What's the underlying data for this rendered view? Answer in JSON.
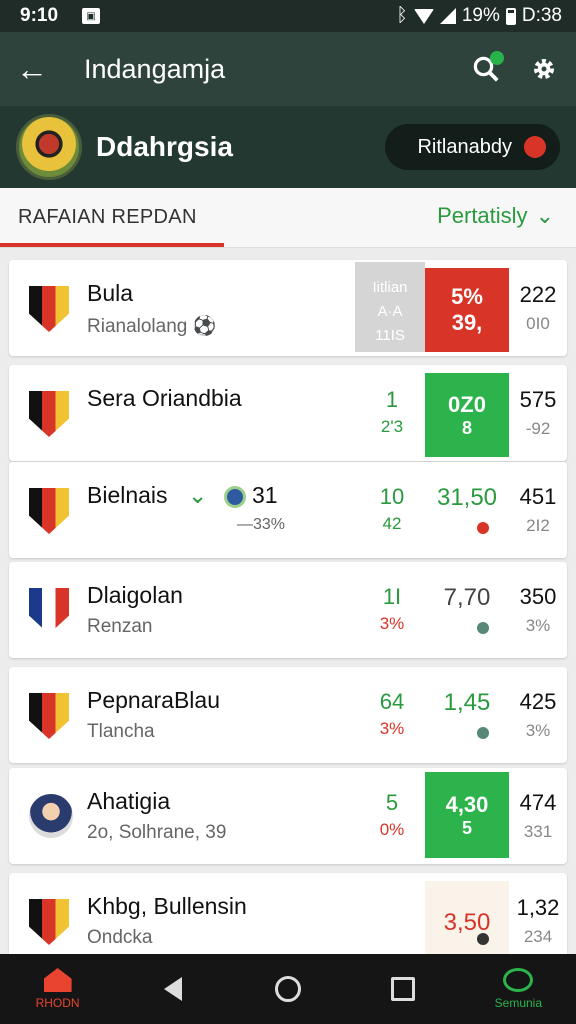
{
  "status": {
    "time": "9:10",
    "battery": "19%",
    "clock": "D:38"
  },
  "appbar": {
    "title": "Indangamja"
  },
  "team": {
    "name": "Ddahrgsia",
    "button_label": "Ritlanabdy"
  },
  "subheader": {
    "tab_label": "RAFAIAN REPDAN",
    "filter_label": "Pertatisly",
    "filter_chevron": "⌄"
  },
  "rows": [
    {
      "name": "Bula",
      "sub": "Rianalolang",
      "sub_icon": "⚽",
      "grey_top": "Iitlian",
      "grey_mid": "A·A",
      "grey_bot": "11IS",
      "odds_top": "5%",
      "odds_bot": "39,",
      "right_top": "222",
      "right_bot": "0I0"
    },
    {
      "name": "Sera Oriandbia",
      "c1": "1",
      "c1b": "2'3",
      "odds_top": "0Z0",
      "odds_bot": "8",
      "right_top": "575",
      "right_bot": "-92"
    },
    {
      "name": "Bielnais",
      "chevron": "⌄",
      "pct": "31",
      "pct_sub": "—33%",
      "c1": "10",
      "c1b": "42",
      "c2": "31,50",
      "right_top": "451",
      "right_bot": "2I2"
    },
    {
      "name": "Dlaigolan",
      "sub": "Renzan",
      "c1": "1I",
      "c1b": "3%",
      "c2": "7,70",
      "right_top": "350",
      "right_bot": "3%"
    },
    {
      "name": "PepnaraBlau",
      "sub": "Tlancha",
      "c1": "64",
      "c1b": "3%",
      "c2": "1,45",
      "right_top": "425",
      "right_bot": "3%"
    },
    {
      "name": "Ahatigia",
      "sub": "2o, Solhrane, 39",
      "c1": "5",
      "c1b": "0%",
      "odds_top": "4,30",
      "odds_bot": "5",
      "right_top": "474",
      "right_bot": "331"
    },
    {
      "name": "Khbg, Bullensin",
      "sub": "Ondcka",
      "c2": "3,50",
      "right_top": "1,32",
      "right_bot": "234"
    }
  ],
  "nav": {
    "home_label": "RHODN",
    "profile_label": "Semunia"
  },
  "colors": {
    "appbar": "#2e433b",
    "accent_green": "#2a9a3e",
    "accent_red": "#d93428"
  }
}
